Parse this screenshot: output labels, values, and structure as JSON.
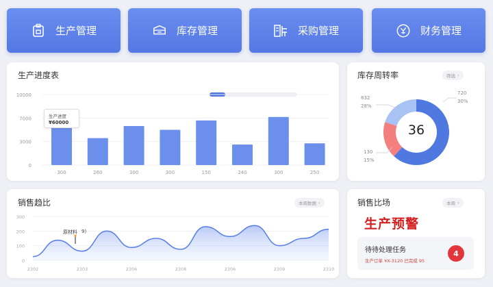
{
  "nav": [
    {
      "label": "生产管理",
      "icon": "production-icon"
    },
    {
      "label": "库存管理",
      "icon": "inventory-icon"
    },
    {
      "label": "采购管理",
      "icon": "purchase-icon"
    },
    {
      "label": "财务管理",
      "icon": "finance-icon"
    }
  ],
  "production": {
    "title": "生产进度表",
    "progress": 0.18,
    "tooltip": {
      "line1": "生产进度",
      "line2": "¥60000"
    },
    "chart_data": {
      "type": "bar",
      "categories": [
        "300",
        "260",
        "300",
        "300",
        "150",
        "240",
        "300",
        "250"
      ],
      "values": [
        1920,
        1300,
        1880,
        1700,
        2150,
        990,
        2320,
        1050
      ],
      "yticks": [
        "10000",
        "7000",
        "3000",
        "0"
      ],
      "ylim": [
        0,
        3400
      ]
    }
  },
  "donut": {
    "title": "库存周转率",
    "filter": "筛选",
    "center": "36",
    "labels": {
      "top_left": [
        "832",
        "28%"
      ],
      "top_right": [
        "720",
        "30%"
      ],
      "bottom_left": [
        "130",
        "15%"
      ]
    },
    "chart_data": {
      "type": "pie",
      "values": [
        62,
        18,
        20
      ],
      "colors": [
        "#4f78e0",
        "#f47f7f",
        "#a9c2f4"
      ]
    }
  },
  "sales": {
    "title": "销售趋比",
    "filter": "本周数据",
    "marker_label": "原材料",
    "marker_value": "9)",
    "xticks": [
      "2302",
      "2303",
      "2306",
      "2308",
      "2306",
      "2309",
      "2310"
    ],
    "yticks": [
      "300",
      "200",
      "100",
      "0"
    ],
    "chart_data": {
      "type": "area",
      "x": [
        0,
        1,
        2,
        3,
        4,
        5,
        6,
        7,
        8,
        9,
        10,
        11,
        12
      ],
      "values": [
        10,
        55,
        25,
        80,
        35,
        60,
        30,
        92,
        65,
        95,
        40,
        60,
        85
      ],
      "ylim": [
        0,
        120
      ]
    }
  },
  "alerts": {
    "title": "销售比场",
    "filter": "本周",
    "warning": "生产预警",
    "task_title": "待待处理任务",
    "task_sub": "生产订单 ¥X-3120 已完成 95",
    "task_badge": "4"
  }
}
